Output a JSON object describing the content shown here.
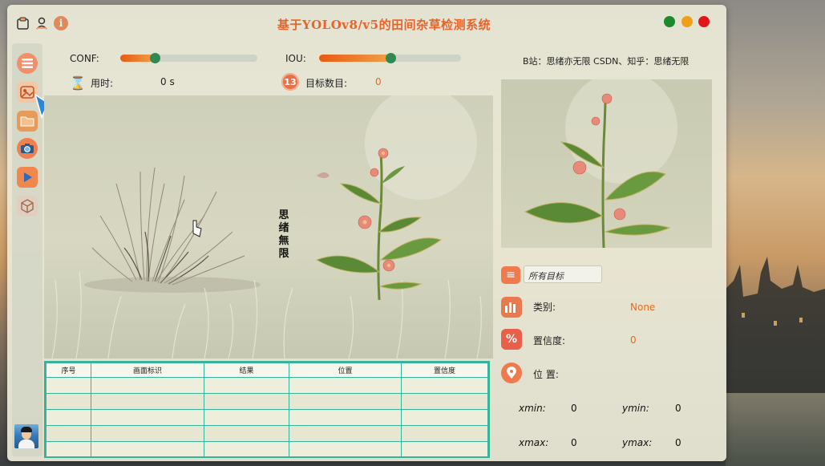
{
  "window": {
    "title": "基于YOLOv8/v5的田间杂草检测系统",
    "controls": {
      "min_color": "#1a8a2a",
      "max_color": "#f0a018",
      "close_color": "#e01818"
    }
  },
  "titlebar_icons": [
    "clipboard-icon",
    "user-icon",
    "info-icon"
  ],
  "sidebar": {
    "items": [
      {
        "name": "menu-list-icon"
      },
      {
        "name": "image-icon"
      },
      {
        "name": "folder-icon"
      },
      {
        "name": "camera-icon"
      },
      {
        "name": "video-play-icon"
      },
      {
        "name": "model-cube-icon"
      }
    ]
  },
  "params": {
    "conf_label": "CONF:",
    "conf_value": 0.25,
    "iou_label": "IOU:",
    "iou_value": 0.5,
    "time_label": "用时:",
    "time_value": "0 s",
    "count_label": "目标数目:",
    "count_value": "0",
    "count_badge": "13"
  },
  "credit": "B站：思绪亦无限  CSDN、知乎：思绪无限",
  "poem": "思绪無限",
  "result": {
    "target_select": "所有目标",
    "class_label": "类别:",
    "class_value": "None",
    "conf_label": "置信度:",
    "conf_value": "0",
    "pos_label": "位 置:",
    "xmin_label": "xmin:",
    "xmin_value": "0",
    "ymin_label": "ymin:",
    "ymin_value": "0",
    "xmax_label": "xmax:",
    "xmax_value": "0",
    "ymax_label": "ymax:",
    "ymax_value": "0"
  },
  "table": {
    "headers": [
      "序号",
      "画面标识",
      "结果",
      "位置",
      "置信度"
    ],
    "rows": 5
  },
  "colors": {
    "accent": "#e8642a",
    "slider_knob": "#2e8a52",
    "table_border": "#36b39a"
  }
}
